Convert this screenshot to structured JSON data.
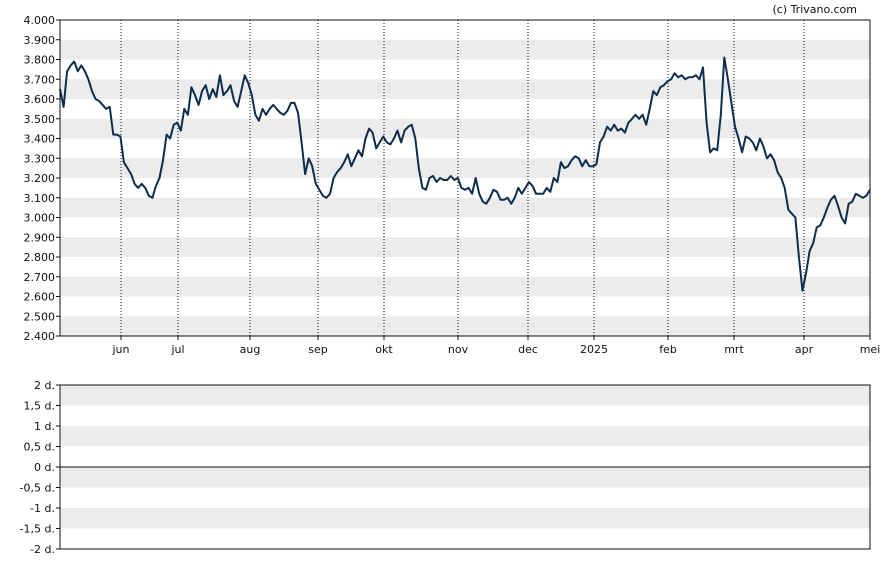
{
  "copyright": "(c) Trivano.com",
  "chart_data": [
    {
      "type": "line",
      "yaxis_ticks": [
        "4.000",
        "3.900",
        "3.800",
        "3.700",
        "3.600",
        "3.500",
        "3.400",
        "3.300",
        "3.200",
        "3.100",
        "3.000",
        "2.900",
        "2.800",
        "2.700",
        "2.600",
        "2.500",
        "2.400"
      ],
      "ylim": [
        2400,
        4000
      ],
      "x_labels": [
        "jun",
        "jul",
        "aug",
        "sep",
        "okt",
        "nov",
        "dec",
        "2025",
        "feb",
        "mrt",
        "apr",
        "mei"
      ],
      "grid": "alternating horizontal bands, dotted vertical month lines",
      "color": "#0d2d4d",
      "series": [
        {
          "values": [
            3650,
            3560,
            3740,
            3770,
            3790,
            3740,
            3770,
            3740,
            3700,
            3640,
            3600,
            3590,
            3570,
            3550,
            3560,
            3420,
            3420,
            3410,
            3280,
            3250,
            3220,
            3170,
            3150,
            3170,
            3150,
            3110,
            3100,
            3160,
            3200,
            3290,
            3420,
            3400,
            3470,
            3480,
            3440,
            3550,
            3520,
            3660,
            3620,
            3570,
            3640,
            3670,
            3600,
            3650,
            3610,
            3720,
            3620,
            3640,
            3670,
            3590,
            3560,
            3640,
            3720,
            3680,
            3620,
            3520,
            3490,
            3550,
            3520,
            3550,
            3570,
            3550,
            3530,
            3520,
            3540,
            3580,
            3580,
            3530,
            3380,
            3220,
            3300,
            3260,
            3170,
            3140,
            3110,
            3100,
            3120,
            3200,
            3230,
            3250,
            3280,
            3320,
            3260,
            3300,
            3340,
            3310,
            3400,
            3450,
            3430,
            3350,
            3380,
            3410,
            3380,
            3370,
            3400,
            3440,
            3380,
            3440,
            3460,
            3470,
            3400,
            3250,
            3150,
            3140,
            3200,
            3210,
            3180,
            3200,
            3190,
            3190,
            3210,
            3190,
            3200,
            3150,
            3140,
            3150,
            3120,
            3200,
            3120,
            3080,
            3070,
            3100,
            3140,
            3130,
            3090,
            3090,
            3100,
            3070,
            3100,
            3150,
            3120,
            3150,
            3180,
            3160,
            3120,
            3120,
            3120,
            3150,
            3130,
            3200,
            3180,
            3280,
            3250,
            3260,
            3290,
            3310,
            3300,
            3260,
            3290,
            3260,
            3260,
            3270,
            3380,
            3410,
            3460,
            3440,
            3470,
            3440,
            3450,
            3430,
            3480,
            3500,
            3520,
            3500,
            3520,
            3470,
            3550,
            3640,
            3620,
            3660,
            3670,
            3690,
            3700,
            3730,
            3710,
            3720,
            3700,
            3710,
            3710,
            3720,
            3700,
            3760,
            3480,
            3330,
            3350,
            3340,
            3520,
            3810,
            3700,
            3580,
            3460,
            3400,
            3330,
            3410,
            3400,
            3380,
            3340,
            3400,
            3360,
            3300,
            3320,
            3290,
            3230,
            3200,
            3150,
            3040,
            3020,
            3000,
            2800,
            2630,
            2720,
            2830,
            2870,
            2950,
            2960,
            3000,
            3050,
            3090,
            3110,
            3060,
            3000,
            2970,
            3070,
            3080,
            3120,
            3110,
            3100,
            3110,
            3140
          ]
        }
      ]
    },
    {
      "type": "line",
      "yaxis_ticks": [
        "2 d.",
        "1,5 d.",
        "1 d.",
        "0,5 d.",
        "0 d.",
        "-0,5 d.",
        "-1 d.",
        "-1,5 d.",
        "-2 d."
      ],
      "ylim": [
        -2,
        2
      ],
      "color": "#111111",
      "series": [
        {
          "values": [
            0,
            0
          ]
        }
      ]
    }
  ]
}
